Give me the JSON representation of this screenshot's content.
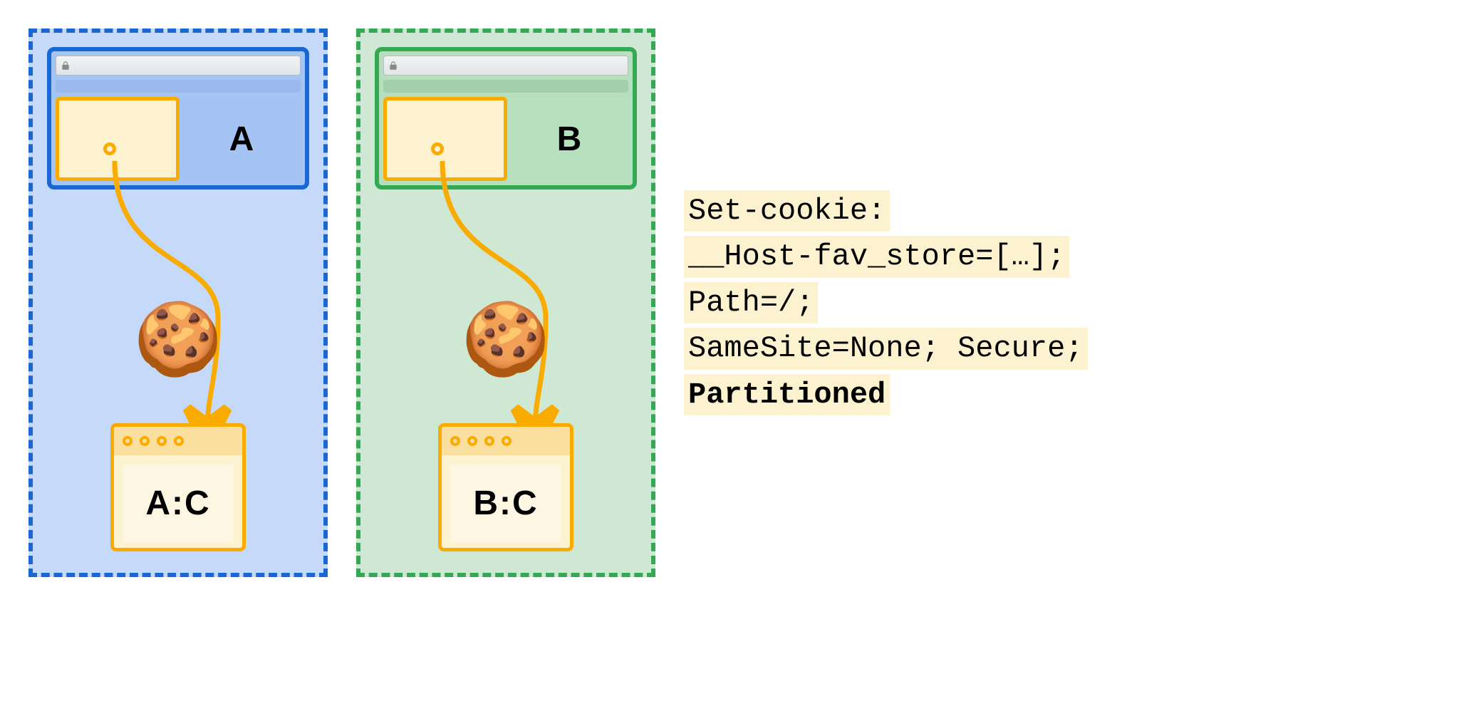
{
  "partitions": [
    {
      "theme": "blue",
      "site_label": "A",
      "jar_label": "A:C"
    },
    {
      "theme": "green",
      "site_label": "B",
      "jar_label": "B:C"
    }
  ],
  "code": {
    "line1": "Set-cookie:",
    "line2": "__Host-fav_store=[…];",
    "line3": "Path=/;",
    "line4": "SameSite=None; Secure;",
    "line5": "Partitioned"
  },
  "icons": {
    "cookie": "🍪"
  }
}
